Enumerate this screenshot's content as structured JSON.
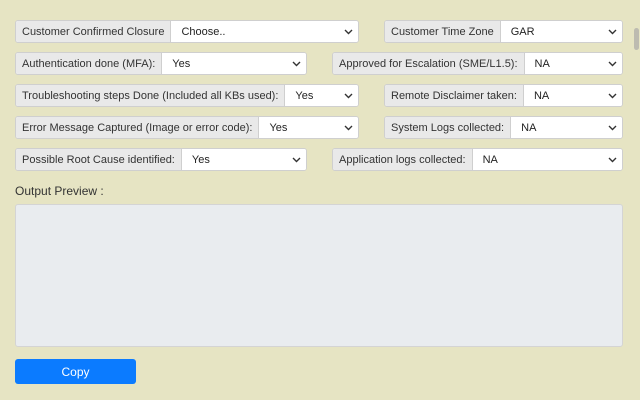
{
  "fields": {
    "customer_confirmed_closure": {
      "label": "Customer Confirmed Closure",
      "value": "Choose.."
    },
    "customer_time_zone": {
      "label": "Customer Time Zone",
      "value": "GAR"
    },
    "authentication_done": {
      "label": "Authentication done (MFA):",
      "value": "Yes"
    },
    "approved_for_escalation": {
      "label": "Approved for Escalation (SME/L1.5):",
      "value": "NA"
    },
    "troubleshooting_steps": {
      "label": "Troubleshooting steps Done (Included all KBs used):",
      "value": "Yes"
    },
    "remote_disclaimer": {
      "label": "Remote Disclaimer taken:",
      "value": "NA"
    },
    "error_message_captured": {
      "label": "Error Message Captured (Image or error code):",
      "value": "Yes"
    },
    "system_logs": {
      "label": "System Logs collected:",
      "value": "NA"
    },
    "root_cause": {
      "label": "Possible Root Cause identified:",
      "value": "Yes"
    },
    "application_logs": {
      "label": "Application logs collected:",
      "value": "NA"
    }
  },
  "output_preview": {
    "label": "Output Preview :",
    "value": ""
  },
  "copy_button": {
    "label": "Copy"
  },
  "colors": {
    "background": "#e6e4c3",
    "accent": "#0b7bff"
  },
  "icons": {
    "dropdown": "chevron-down-icon"
  }
}
